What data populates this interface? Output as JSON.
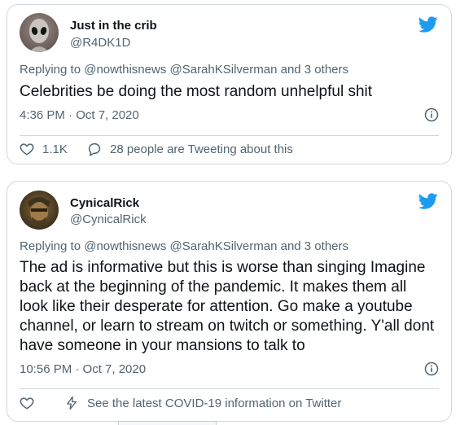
{
  "colors": {
    "accent": "#1d9bf0",
    "text_primary": "#0f1419",
    "text_secondary": "#536471",
    "border": "#cfd9de"
  },
  "tweets": [
    {
      "display_name": "Just in the crib",
      "handle": "@R4DK1D",
      "reply_prefix": "Replying to",
      "reply_mentions": "@nowthisnews @SarahKSilverman and 3 others",
      "text": "Celebrities be doing the most random unhelpful shit",
      "timestamp": "4:36 PM · Oct 7, 2020",
      "likes": "1.1K",
      "conversation": "28 people are Tweeting about this",
      "icons": {
        "avatar": "alien-avatar",
        "brand": "twitter-bird-icon",
        "info": "info-icon",
        "like": "heart-icon",
        "reply": "speech-bubble-icon"
      }
    },
    {
      "display_name": "CynicalRick",
      "handle": "@CynicalRick",
      "reply_prefix": "Replying to",
      "reply_mentions": "@nowthisnews @SarahKSilverman and 3 others",
      "text_lines": [
        "The ad is informative but this is worse than singing Imagine",
        "back at the beginning of the pandemic. It makes them all",
        "look like their desperate for attention. Go make a youtube",
        "channel, or learn to stream on twitch or something. Y'all dont",
        "have someone in your mansions to talk to"
      ],
      "timestamp": "10:56 PM · Oct 7, 2020",
      "covid_notice": "See the latest COVID-19 information on Twitter",
      "icons": {
        "avatar": "rick-avatar",
        "brand": "twitter-bird-icon",
        "info": "info-icon",
        "like": "heart-icon",
        "notice": "lightning-bolt-icon"
      }
    }
  ]
}
